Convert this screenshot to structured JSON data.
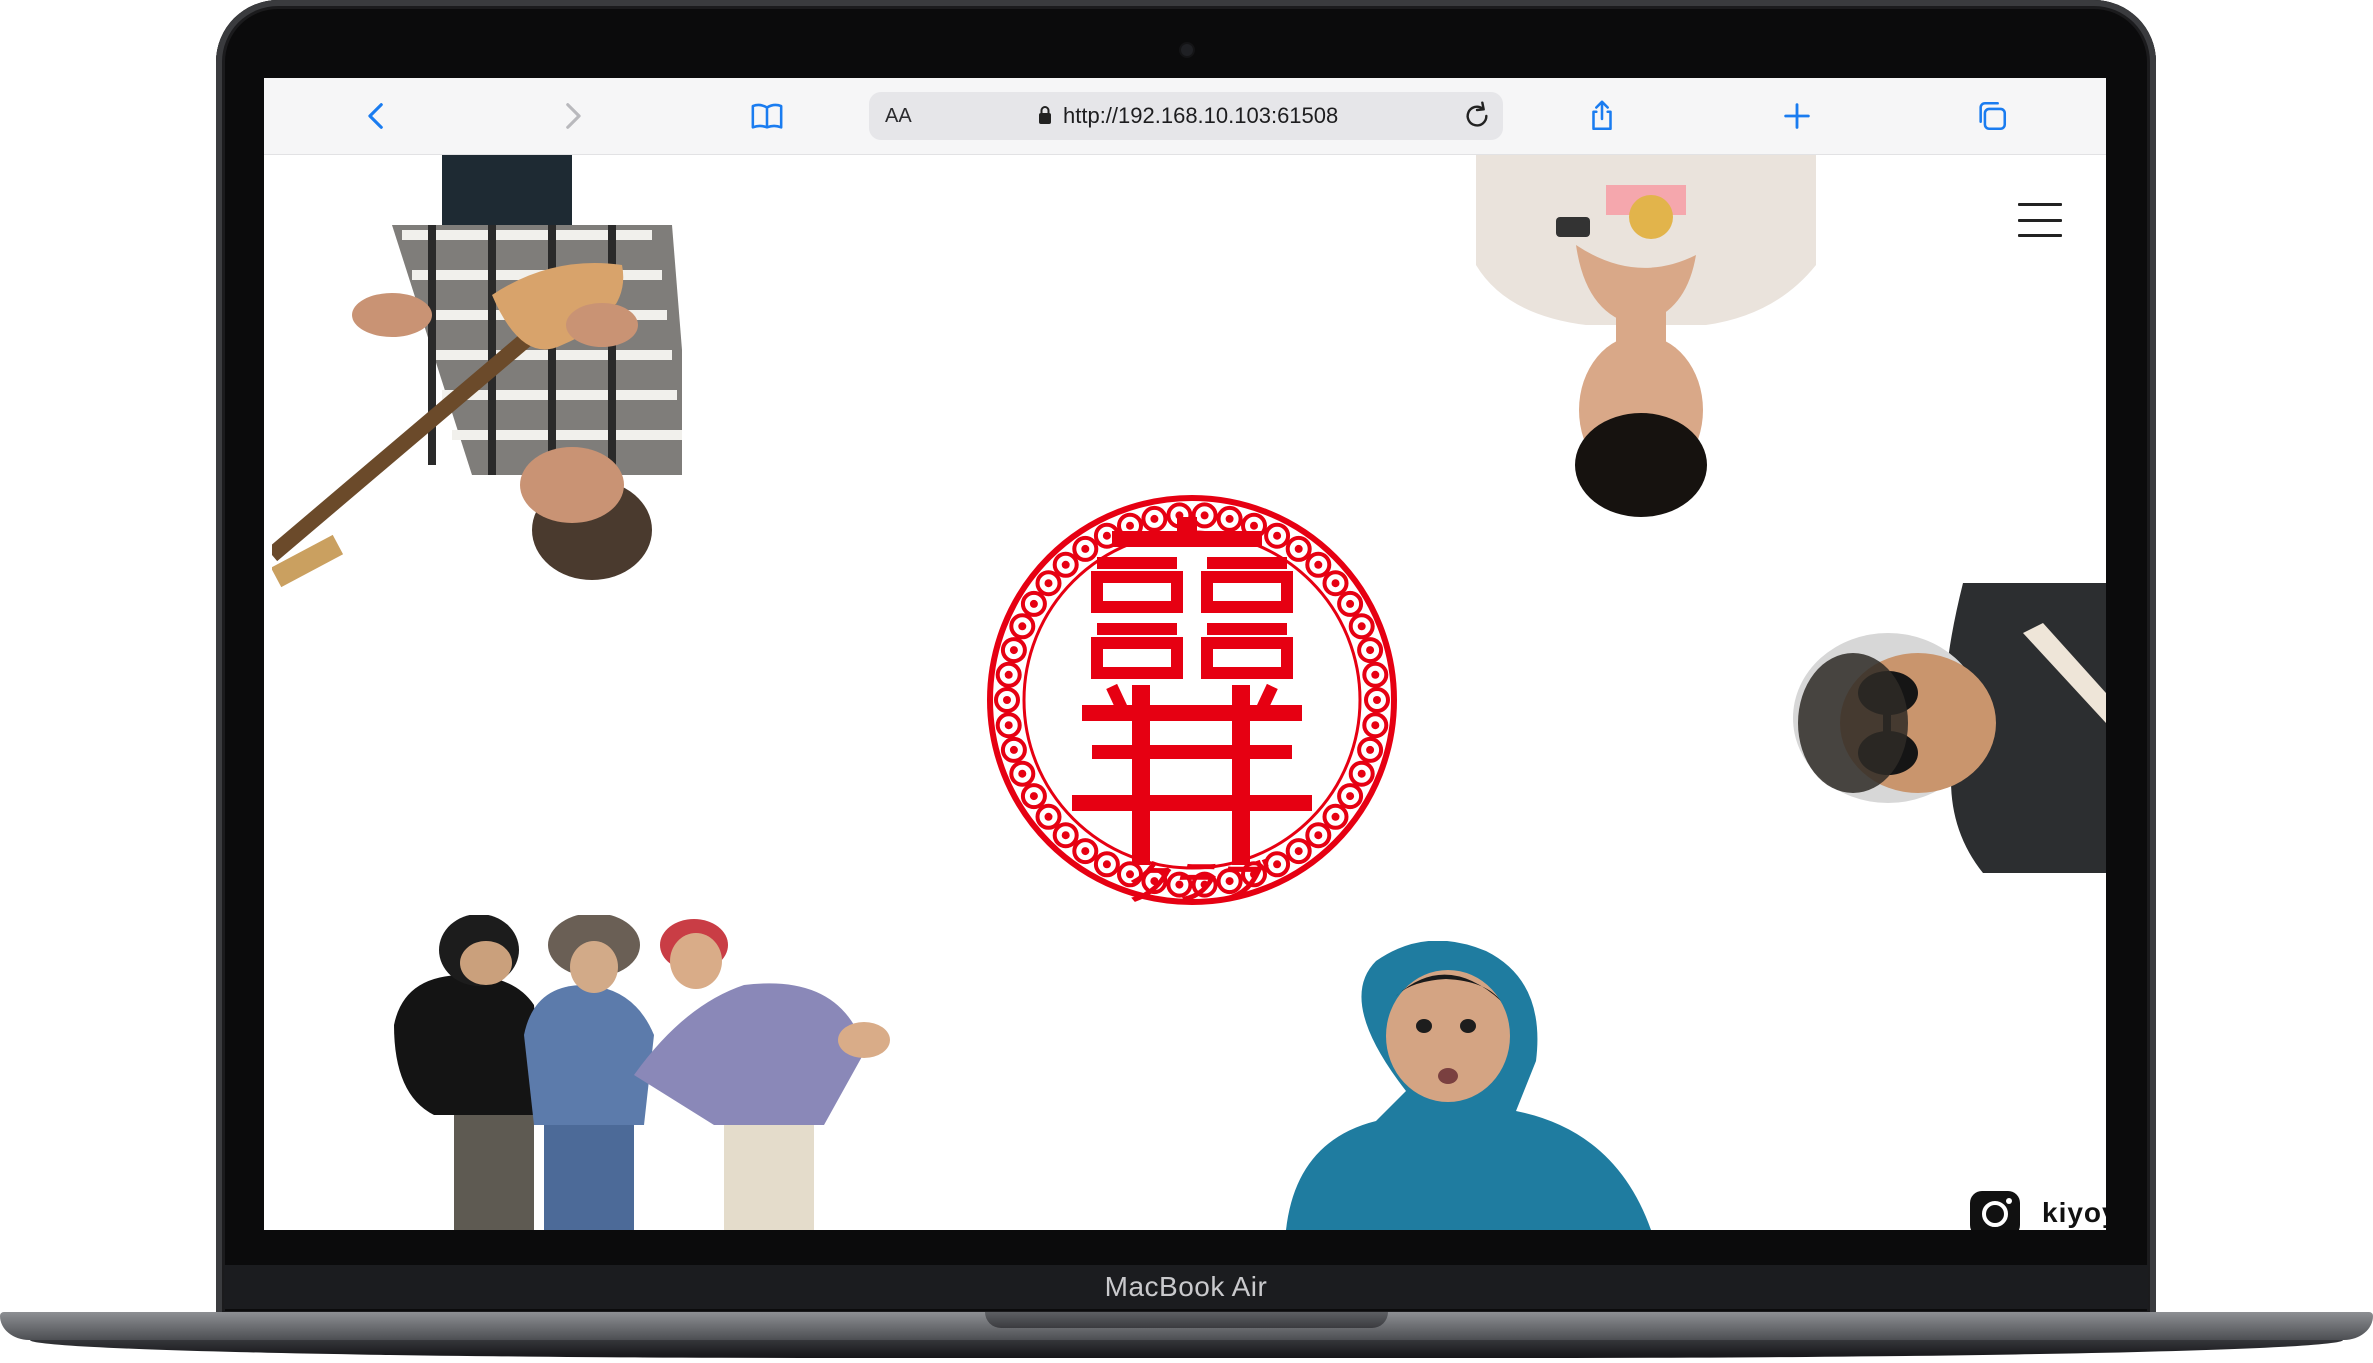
{
  "device": {
    "model_label": "MacBook Air"
  },
  "browser": {
    "text_size_label": "AA",
    "url": "http://192.168.10.103:61508",
    "icons": [
      "back-icon",
      "forward-icon",
      "bookmarks-icon",
      "lock-icon",
      "reload-icon",
      "share-icon",
      "new-tab-icon",
      "tabs-icon"
    ]
  },
  "page": {
    "menu_icon": "hamburger-menu-icon",
    "logo": {
      "name": "club-logo",
      "text": "クラブ",
      "color": "#e60012"
    },
    "social": {
      "icon": "instagram-icon",
      "handle": "kiyoy"
    }
  },
  "colors": {
    "accent": "#1a7cf0",
    "brand_red": "#e60012"
  }
}
